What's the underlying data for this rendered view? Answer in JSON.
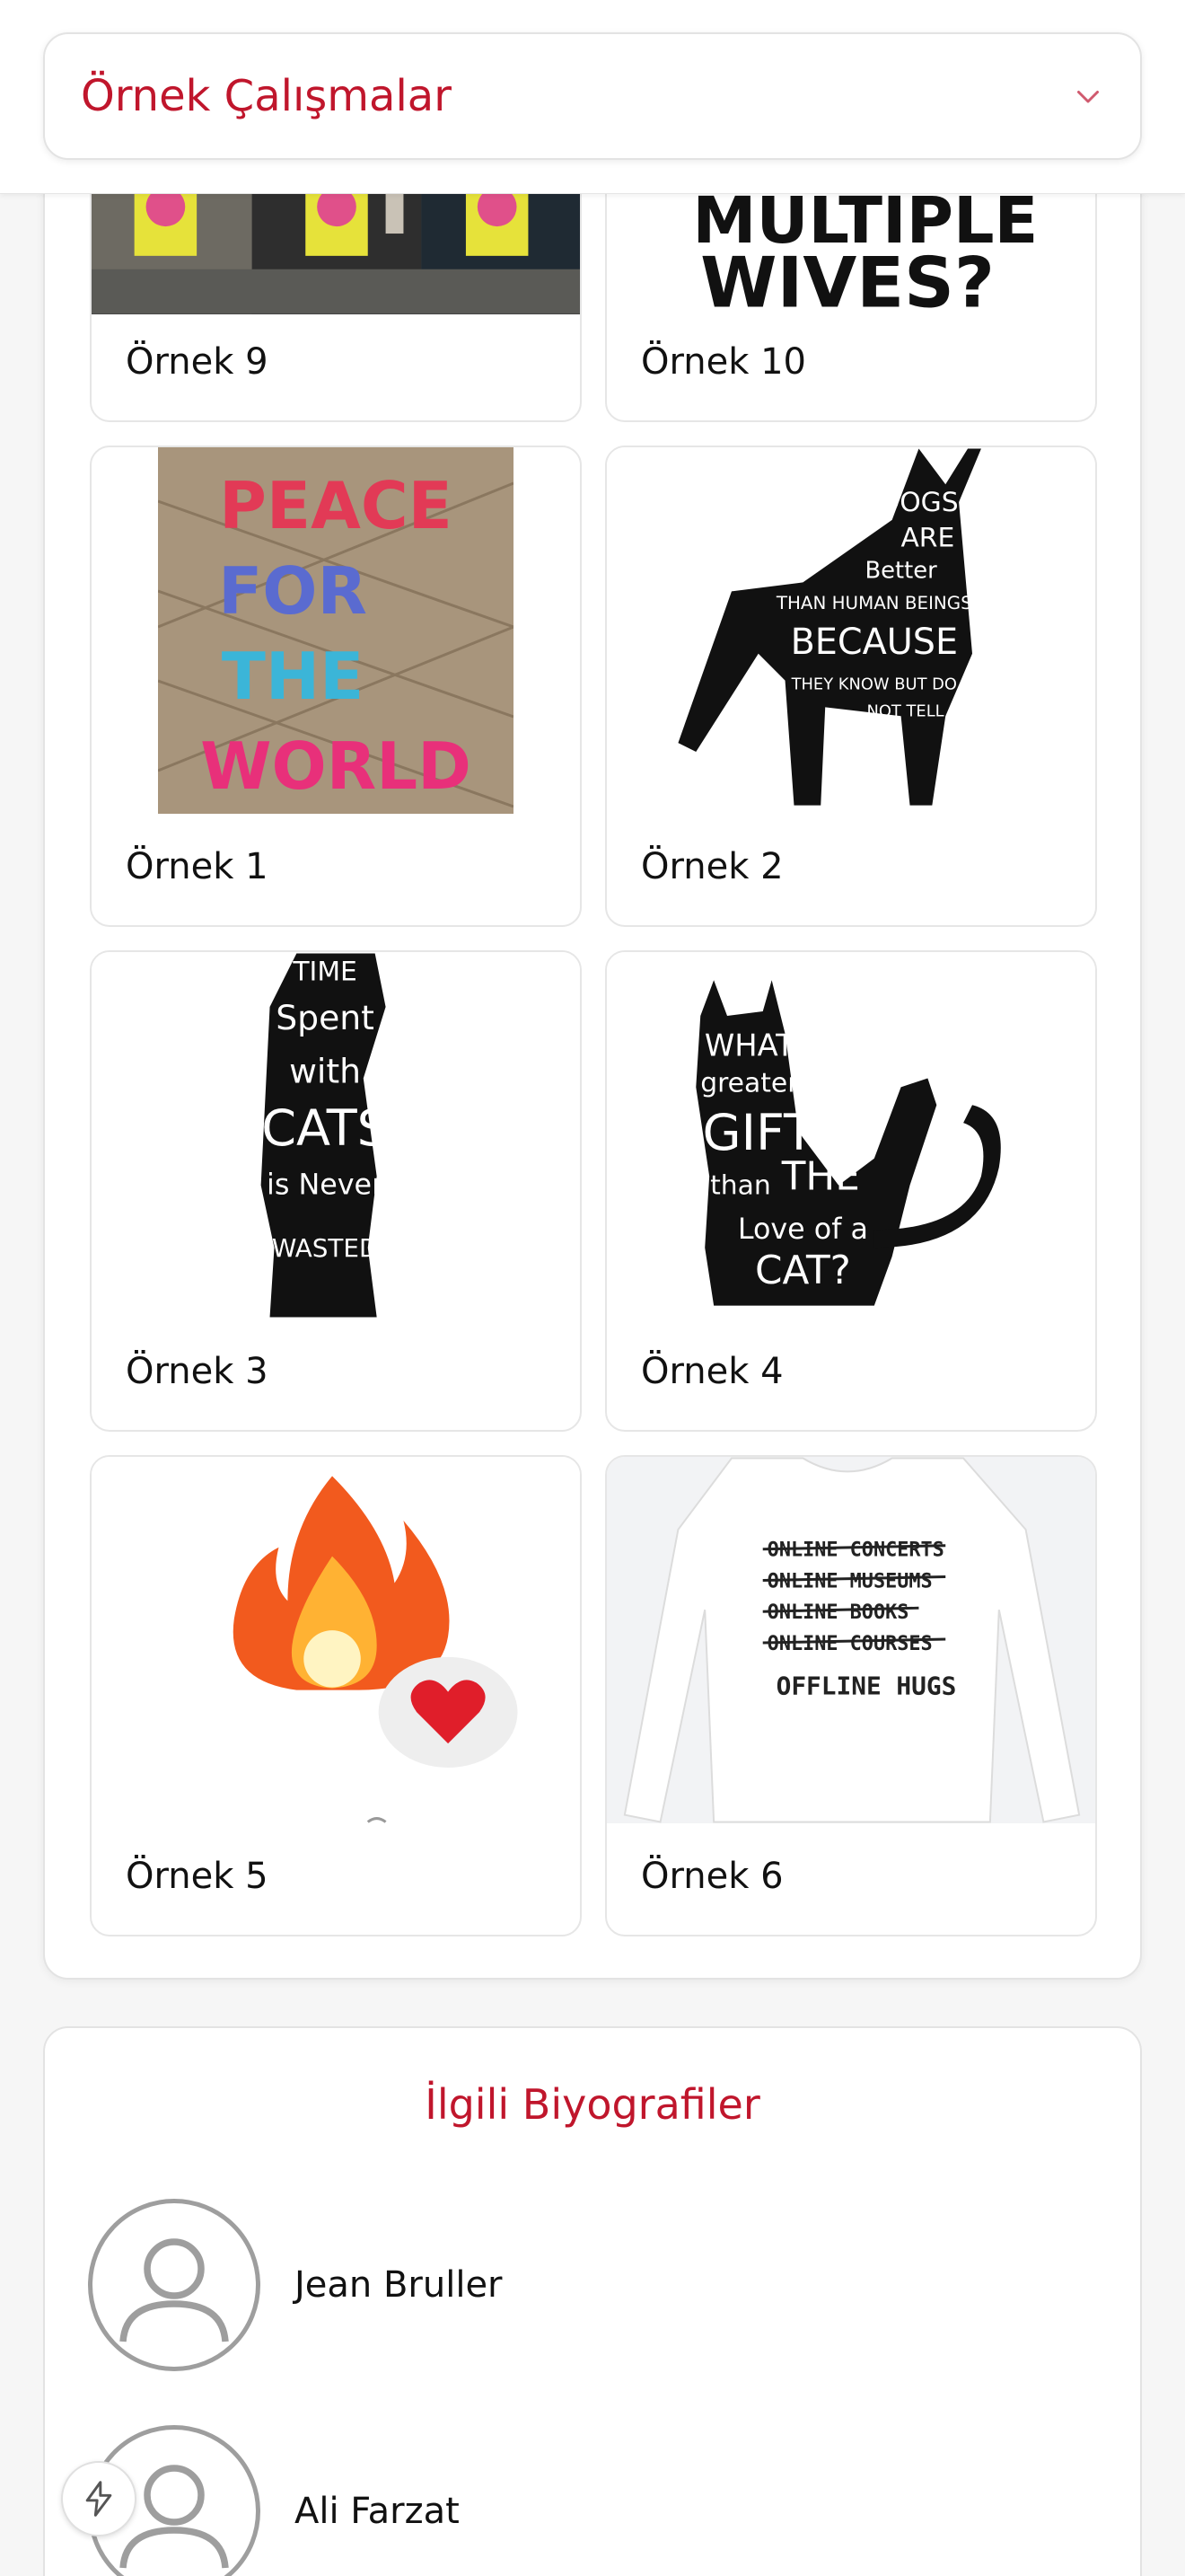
{
  "header": {
    "title": "Örnek Çalışmalar",
    "toggle_icon": "chevron-down-icon"
  },
  "gallery": {
    "items": [
      {
        "label": "Örnek 9",
        "image": "street-bus-stop-posters"
      },
      {
        "label": "Örnek 10",
        "image": "multiple-wives-typography"
      },
      {
        "label": "Örnek 1",
        "image": "peace-for-the-world-clay-letters"
      },
      {
        "label": "Örnek 2",
        "image": "dog-silhouette-typography"
      },
      {
        "label": "Örnek 3",
        "image": "cat-silhouette-time-spent-with-cats"
      },
      {
        "label": "Örnek 4",
        "image": "cat-silhouette-greater-gift"
      },
      {
        "label": "Örnek 5",
        "image": "fire-and-heart-emoji"
      },
      {
        "label": "Örnek 6",
        "image": "offline-hugs-long-sleeve-shirt"
      }
    ]
  },
  "related": {
    "title": "İlgili Biyografiler",
    "people": [
      {
        "name": "Jean Bruller",
        "avatar": "user-placeholder-icon"
      },
      {
        "name": "Ali Farzat",
        "avatar": "user-placeholder-icon"
      }
    ]
  },
  "tile_texts": {
    "multiple": "MULTIPLE",
    "wives": "WIVES?",
    "peace_words": [
      "PEACE",
      "FOR",
      "THE",
      "WORLD"
    ],
    "dogs": [
      "DOGS",
      "ARE",
      "Better",
      "THAN HUMAN BEINGS",
      "BECAUSE",
      "THEY KNOW BUT DO",
      "NOT TELL"
    ],
    "cat3": [
      "TIME",
      "Spent",
      "with",
      "CATS",
      "is Never",
      "WASTED"
    ],
    "cat4": [
      "WHAT",
      "greater",
      "GIFT",
      "than",
      "THE",
      "Love of a",
      "CAT?"
    ],
    "shirt": [
      "ONLINE CONCERTS",
      "ONLINE MUSEUMS",
      "ONLINE BOOKS",
      "ONLINE COURSES",
      "OFFLINE HUGS"
    ]
  },
  "colors": {
    "accent": "#c0162c",
    "border": "#e3e3e3",
    "text": "#111111"
  },
  "fab": {
    "icon": "lightning-bolt-icon"
  }
}
